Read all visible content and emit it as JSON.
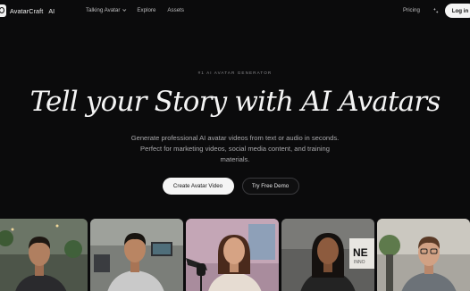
{
  "header": {
    "brand": "AvatarCraft",
    "brand_suffix": "AI",
    "nav": [
      {
        "label": "Talking Avatar",
        "has_dropdown": true
      },
      {
        "label": "Explore",
        "has_dropdown": false
      },
      {
        "label": "Assets",
        "has_dropdown": false
      }
    ],
    "pricing": "Pricing",
    "theme_icon": "sparkle-icon",
    "login": "Log in"
  },
  "hero": {
    "eyebrow": "#1 AI AVATAR GENERATOR",
    "title": "Tell your Story with AI Avatars",
    "subtitle": "Generate professional AI avatar videos from text or audio in seconds. Perfect for marketing videos, social media content, and training materials.",
    "primary_cta": "Create Avatar Video",
    "secondary_cta": "Try Free Demo"
  },
  "gallery": {
    "cards": [
      {
        "name": "avatar-card-1",
        "bg": "#5f6a5c",
        "skin": "#b07f60",
        "hair": "#1e1712",
        "shirt": "#2b2b2e"
      },
      {
        "name": "avatar-card-2",
        "bg": "#8c8f8a",
        "skin": "#b98563",
        "hair": "#181410",
        "shirt": "#cfcfcf"
      },
      {
        "name": "avatar-card-3",
        "bg": "#b59aa8",
        "skin": "#d6a384",
        "hair": "#4a2a1c",
        "shirt": "#e9dfd6"
      },
      {
        "name": "avatar-card-4",
        "bg": "#6f6f6d",
        "skin": "#8d5b3e",
        "hair": "#15110f",
        "shirt": "#242424"
      },
      {
        "name": "avatar-card-5",
        "bg": "#b8b5ae",
        "skin": "#d1a184",
        "hair": "#5a3a26",
        "shirt": "#6c7278"
      }
    ],
    "card4_sign": "NE",
    "card4_sign_sub": "INNO"
  }
}
